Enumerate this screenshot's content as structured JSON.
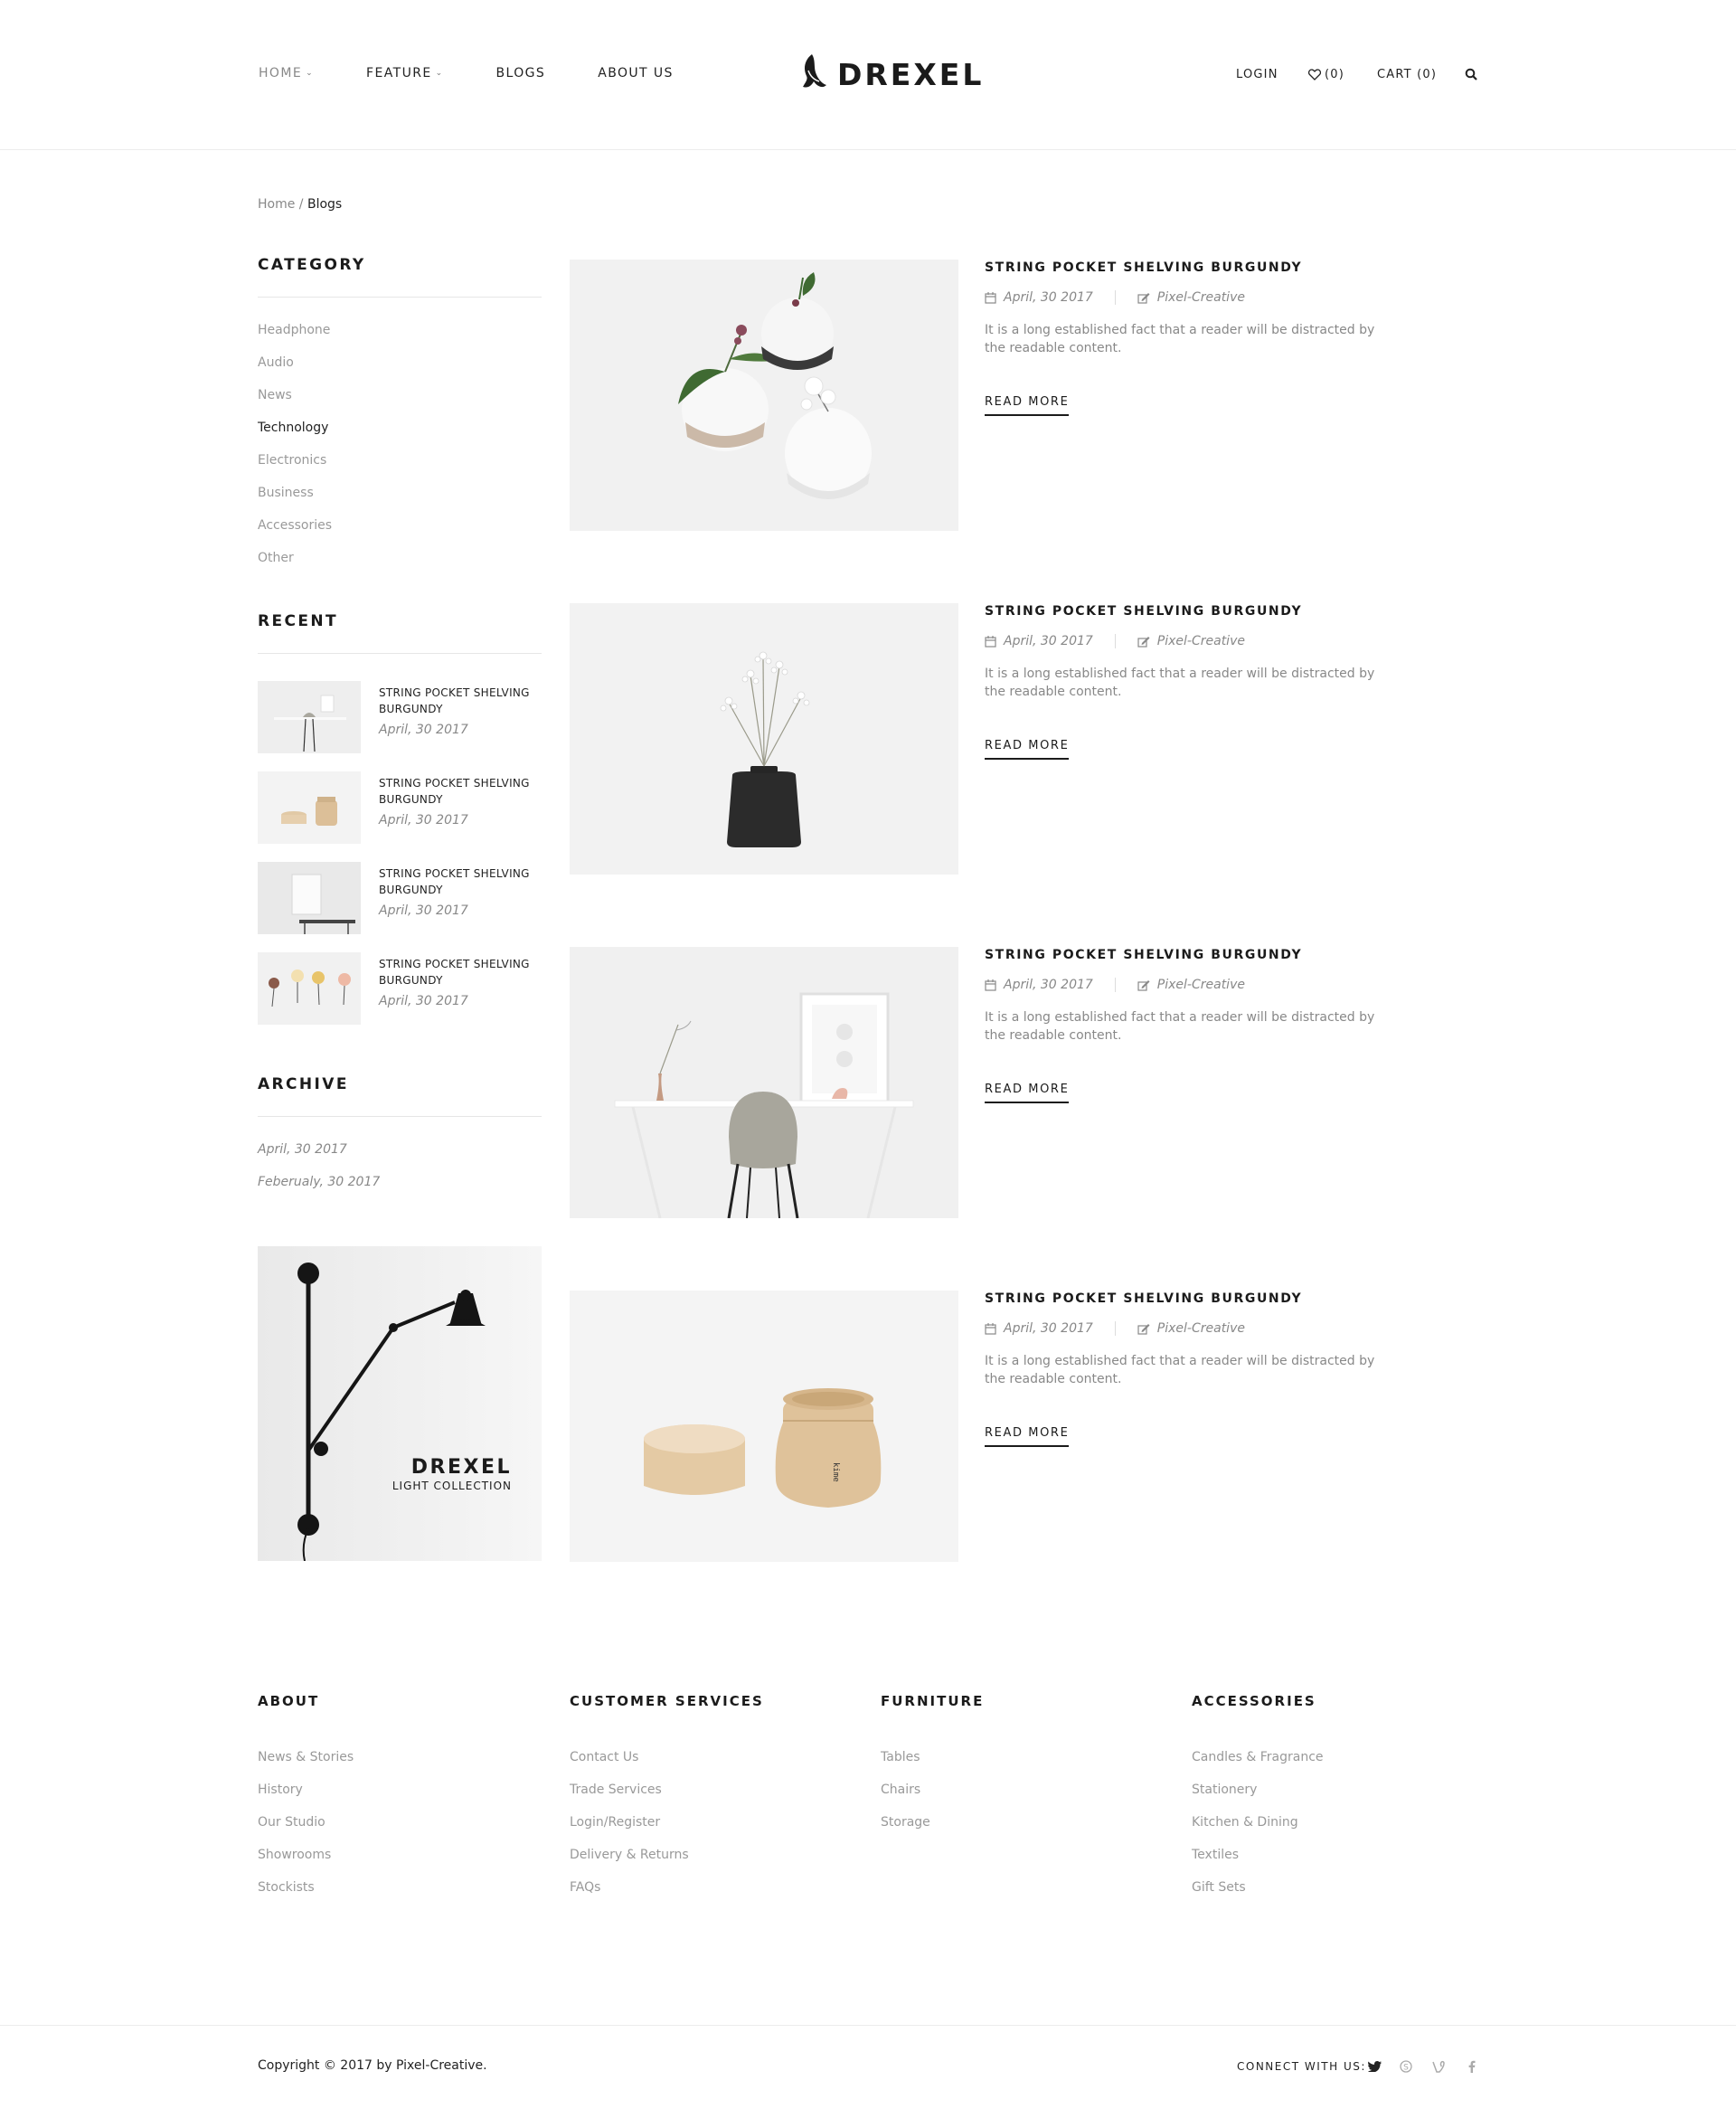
{
  "header": {
    "nav": [
      {
        "label": "HOME",
        "has_dropdown": true,
        "active": true
      },
      {
        "label": "FEATURE",
        "has_dropdown": true,
        "active": false
      },
      {
        "label": "BLOGS",
        "has_dropdown": false,
        "active": false
      },
      {
        "label": "ABOUT US",
        "has_dropdown": false,
        "active": false
      }
    ],
    "logo_text": "DREXEL",
    "login_label": "LOGIN",
    "wishlist_label": "(0)",
    "cart_label": "CART (0)"
  },
  "breadcrumb": {
    "home": "Home",
    "separator": "/",
    "current": "Blogs"
  },
  "sidebar": {
    "category_heading": "CATEGORY",
    "categories": [
      {
        "label": "Headphone",
        "active": false
      },
      {
        "label": "Audio",
        "active": false
      },
      {
        "label": "News",
        "active": false
      },
      {
        "label": "Technology",
        "active": true
      },
      {
        "label": "Electronics",
        "active": false
      },
      {
        "label": "Business",
        "active": false
      },
      {
        "label": "Accessories",
        "active": false
      },
      {
        "label": "Other",
        "active": false
      }
    ],
    "recent_heading": "RECENT",
    "recent": [
      {
        "title": "STRING POCKET SHELVING BURGUNDY",
        "date": "April, 30 2017"
      },
      {
        "title": "STRING POCKET SHELVING BURGUNDY",
        "date": "April, 30 2017"
      },
      {
        "title": "STRING POCKET SHELVING BURGUNDY",
        "date": "April, 30 2017"
      },
      {
        "title": "STRING POCKET SHELVING BURGUNDY",
        "date": "April, 30 2017"
      }
    ],
    "archive_heading": "ARCHIVE",
    "archive": [
      "April, 30 2017",
      "Feberualy, 30 2017"
    ],
    "promo": {
      "title": "DREXEL",
      "subtitle": "LIGHT COLLECTION"
    }
  },
  "posts": [
    {
      "title": "STRING POCKET SHELVING BURGUNDY",
      "date": "April, 30 2017",
      "author": "Pixel-Creative",
      "excerpt": "It is a long established fact that a reader will be distracted by the readable content.",
      "read_more": "READ MORE"
    },
    {
      "title": "STRING POCKET SHELVING BURGUNDY",
      "date": "April, 30 2017",
      "author": "Pixel-Creative",
      "excerpt": "It is a long established fact that a reader will be distracted by the readable content.",
      "read_more": "READ MORE"
    },
    {
      "title": "STRING POCKET SHELVING BURGUNDY",
      "date": "April, 30 2017",
      "author": "Pixel-Creative",
      "excerpt": "It is a long established fact that a reader will be distracted by the readable content.",
      "read_more": "READ MORE"
    },
    {
      "title": "STRING POCKET SHELVING BURGUNDY",
      "date": "April, 30 2017",
      "author": "Pixel-Creative",
      "excerpt": "It is a long established fact that a reader will be distracted by the readable content.",
      "read_more": "READ MORE"
    }
  ],
  "footer": {
    "columns": [
      {
        "heading": "ABOUT",
        "links": [
          "News & Stories",
          "History",
          "Our Studio",
          "Showrooms",
          "Stockists"
        ]
      },
      {
        "heading": "CUSTOMER SERVICES",
        "links": [
          "Contact Us",
          "Trade Services",
          "Login/Register",
          "Delivery & Returns",
          "FAQs"
        ]
      },
      {
        "heading": "FURNITURE",
        "links": [
          "Tables",
          "Chairs",
          "Storage"
        ]
      },
      {
        "heading": "ACCESSORIES",
        "links": [
          "Candles & Fragrance",
          "Stationery",
          "Kitchen & Dining",
          "Textiles",
          "Gift Sets"
        ]
      }
    ],
    "copyright": "Copyright © 2017 by Pixel-Creative.",
    "connect_label": "CONNECT WITH US:",
    "social_icons": [
      "twitter-icon",
      "skype-icon",
      "vine-icon",
      "facebook-icon"
    ]
  },
  "colors": {
    "text_dark": "#1b1b1b",
    "text_muted": "#888888",
    "rule": "#e6e6e6"
  }
}
